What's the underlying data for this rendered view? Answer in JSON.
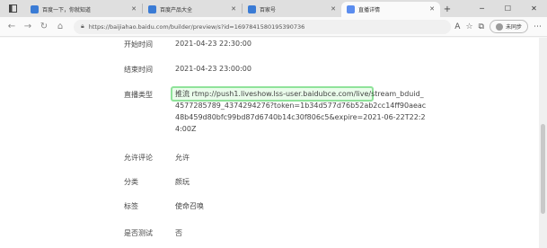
{
  "tabs": [
    {
      "label": "百度一下，你就知道",
      "favicon_color": "#3a7bd5"
    },
    {
      "label": "百度产品大全",
      "favicon_color": "#3a7bd5"
    },
    {
      "label": "百家号",
      "favicon_color": "#3a7bd5"
    },
    {
      "label": "直播详情",
      "favicon_color": "#5b8def",
      "active": true
    }
  ],
  "address_bar": {
    "url": "https://baijiahao.baidu.com/builder/preview/s?id=1697841580195390736"
  },
  "profile": {
    "label": "未同步"
  },
  "rows": {
    "start": {
      "label": "开始时间",
      "value": "2021-04-23 22:30:00"
    },
    "end": {
      "label": "结束时间",
      "value": "2021-04-23 23:00:00"
    },
    "type": {
      "label": "直播类型"
    },
    "comment": {
      "label": "允许评论",
      "value": "允许"
    },
    "category": {
      "label": "分类",
      "value": "颜玩"
    },
    "tag": {
      "label": "标签",
      "value": "使命召唤"
    },
    "test": {
      "label": "是否测试",
      "value": "否"
    }
  },
  "stream": {
    "prefix": "推流",
    "url": "rtmp://push1.liveshow.lss-user.baidubce.com/live/stream_bduid_4577285789_4374294276?token=1b34d577d76b52ab2cc14ff90aeac48b459d80bfc99bd87d6740b14c30f806c5&expire=2021-06-22T22:24:00Z"
  },
  "colors": {
    "highlight": "#8fe39a"
  }
}
